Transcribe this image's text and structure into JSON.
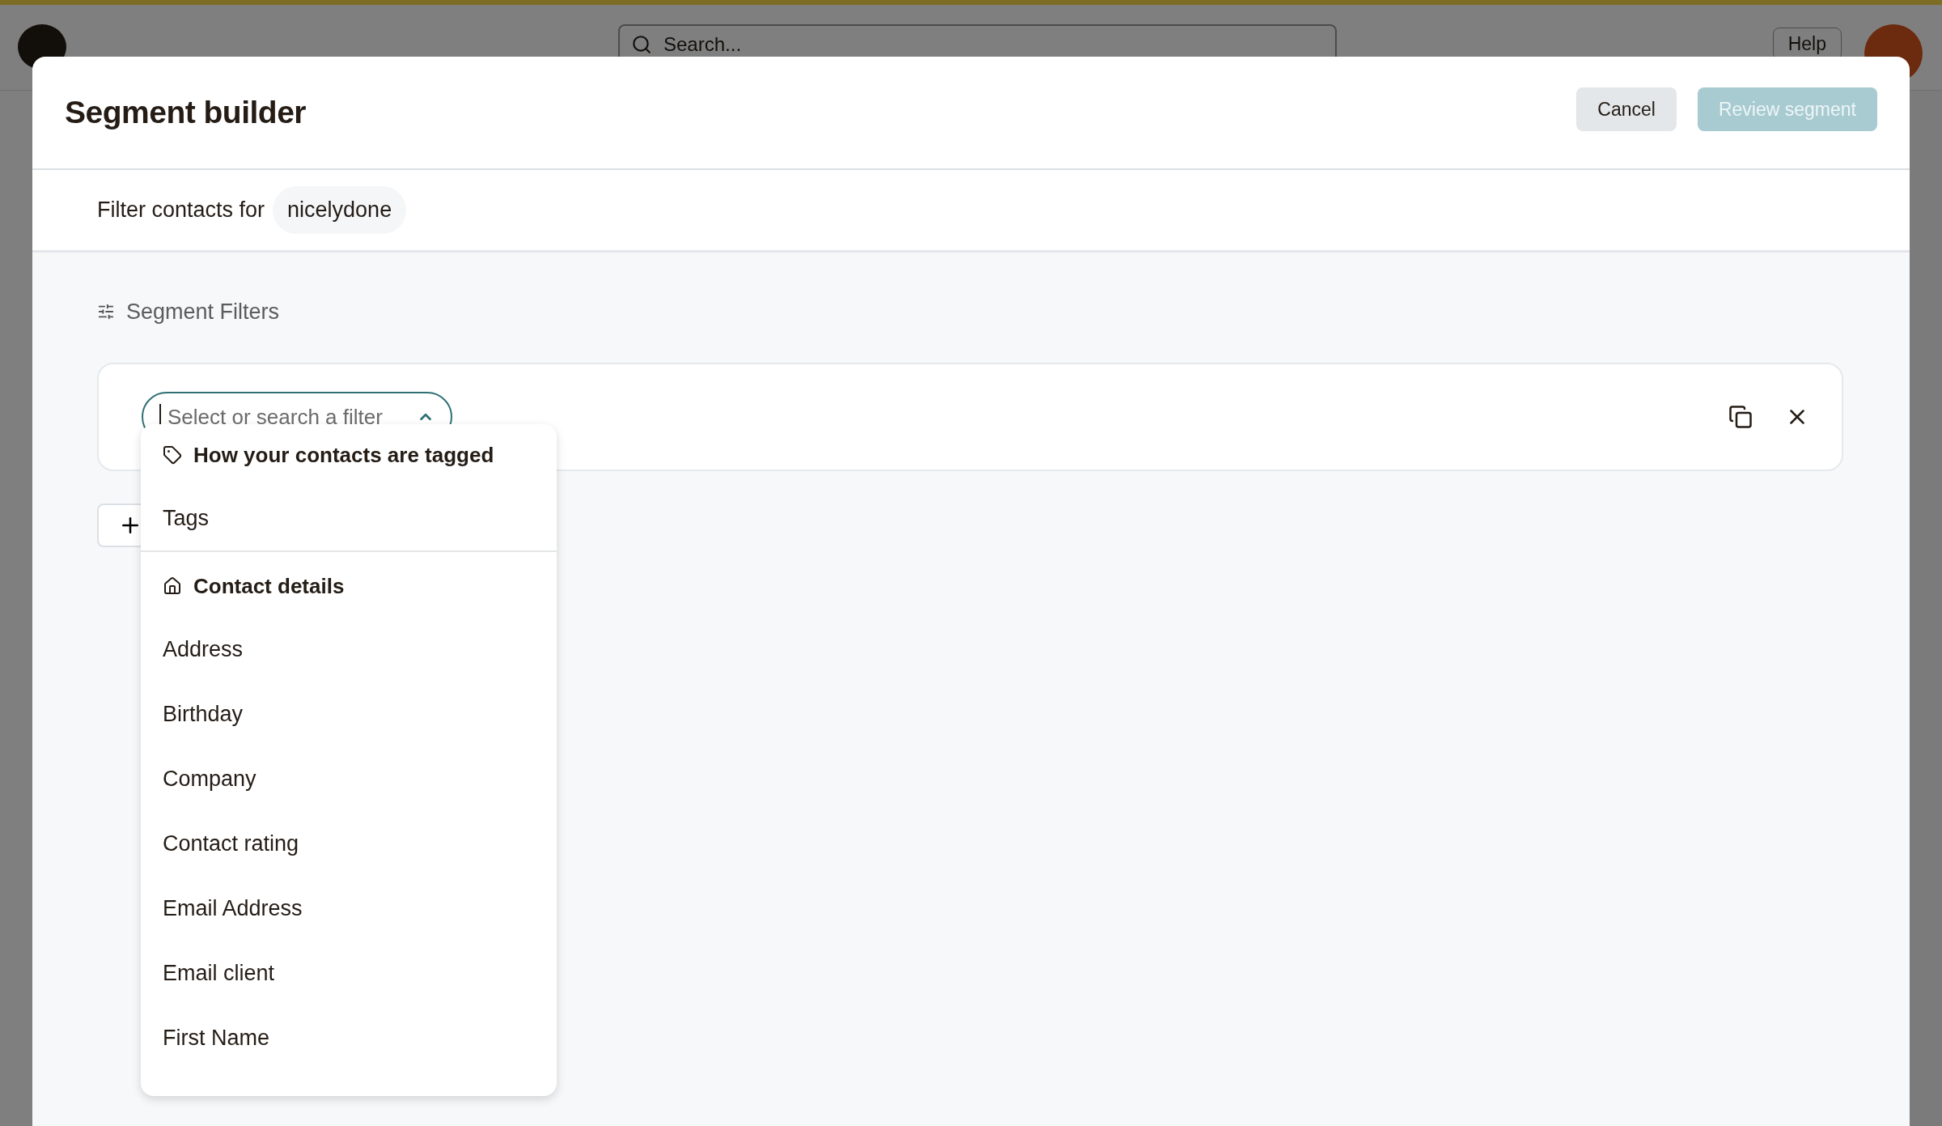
{
  "background": {
    "search": {
      "placeholder": "Search..."
    },
    "help_button": "Help"
  },
  "modal": {
    "title": "Segment builder",
    "buttons": [
      {
        "label": "Cancel",
        "kind": "secondary",
        "disabled": false
      },
      {
        "label": "Review segment",
        "kind": "primary",
        "disabled": true
      }
    ],
    "audience": {
      "label": "Filter contacts for",
      "value": "nicelydone"
    },
    "filters_heading": "Segment Filters",
    "filter_select": {
      "placeholder": "Select or search a filter",
      "expanded": true
    },
    "menu": [
      {
        "heading": "How your contacts are tagged",
        "kind": "tag",
        "items": [
          "Tags"
        ]
      },
      {
        "heading": "Contact details",
        "kind": "home",
        "items": [
          "Address",
          "Birthday",
          "Company",
          "Contact rating",
          "Email Address",
          "Email client",
          "First Name"
        ]
      }
    ]
  }
}
